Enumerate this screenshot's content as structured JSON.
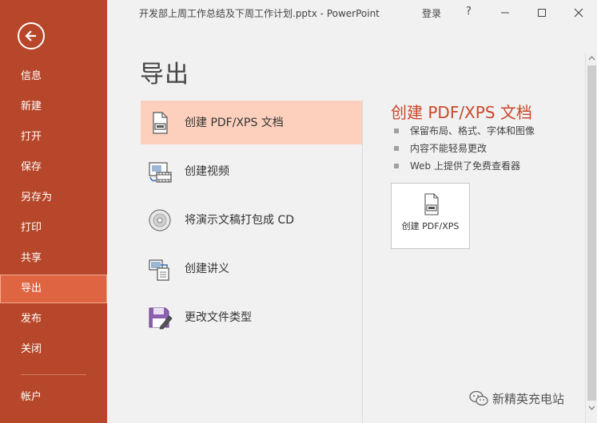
{
  "titlebar": {
    "doc_title": "开发部上周工作总结及下周工作计划.pptx - PowerPoint",
    "signin": "登录",
    "help": "?"
  },
  "sidebar": {
    "items": [
      {
        "label": "信息"
      },
      {
        "label": "新建"
      },
      {
        "label": "打开"
      },
      {
        "label": "保存"
      },
      {
        "label": "另存为"
      },
      {
        "label": "打印"
      },
      {
        "label": "共享"
      },
      {
        "label": "导出",
        "active": true
      },
      {
        "label": "发布"
      },
      {
        "label": "关闭"
      },
      {
        "label": "帐户"
      }
    ]
  },
  "page": {
    "title": "导出"
  },
  "options": [
    {
      "label": "创建 PDF/XPS 文档",
      "icon": "pdf-document-icon",
      "selected": true
    },
    {
      "label": "创建视频",
      "icon": "video-icon"
    },
    {
      "label": "将演示文稿打包成 CD",
      "icon": "cd-icon"
    },
    {
      "label": "创建讲义",
      "icon": "handout-icon"
    },
    {
      "label": "更改文件类型",
      "icon": "save-as-type-icon"
    }
  ],
  "detail": {
    "title": "创建 PDF/XPS 文档",
    "bullets": [
      "保留布局、格式、字体和图像",
      "内容不能轻易更改",
      "Web 上提供了免费查看器"
    ],
    "button_label": "创建 PDF/XPS"
  },
  "watermark": {
    "text": "新精英充电站"
  },
  "colors": {
    "sidebar": "#b7472a",
    "active_item": "#de6442",
    "selected_option": "#fcd0bd",
    "accent_text": "#c9482a"
  }
}
